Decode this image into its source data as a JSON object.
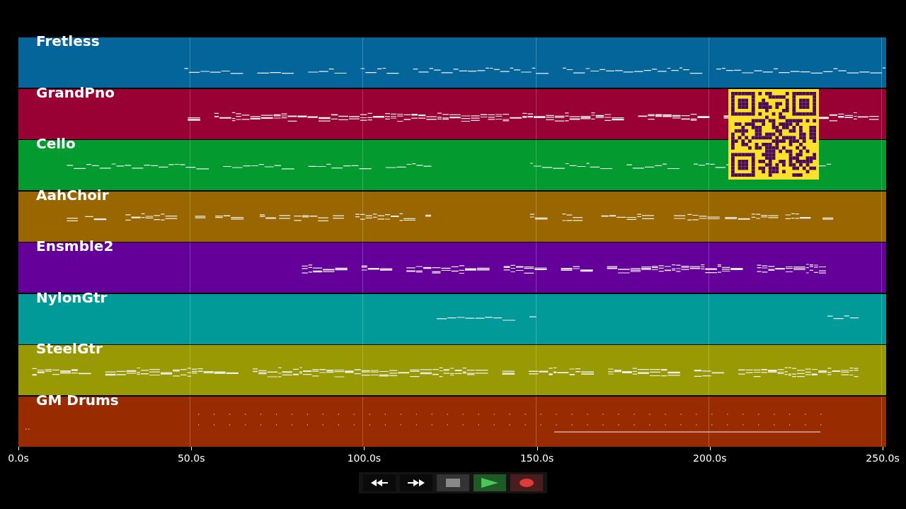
{
  "tracks": [
    {
      "name": "Fretless",
      "color": "#04659b"
    },
    {
      "name": "GrandPno",
      "color": "#990033"
    },
    {
      "name": "Cello",
      "color": "#039a30"
    },
    {
      "name": "AahChoir",
      "color": "#9a6600"
    },
    {
      "name": "Ensmble2",
      "color": "#640099"
    },
    {
      "name": "NylonGtr",
      "color": "#029999"
    },
    {
      "name": "SteelGtr",
      "color": "#999903"
    },
    {
      "name": "GM Drums",
      "color": "#992b00"
    }
  ],
  "time_axis": {
    "ticks": [
      "0.0s",
      "50.0s",
      "100.0s",
      "150.0s",
      "200.0s",
      "250.0s"
    ]
  },
  "transport": [
    {
      "kind": "rewind"
    },
    {
      "kind": "forward"
    },
    {
      "kind": "stop"
    },
    {
      "kind": "play"
    },
    {
      "kind": "record"
    }
  ]
}
